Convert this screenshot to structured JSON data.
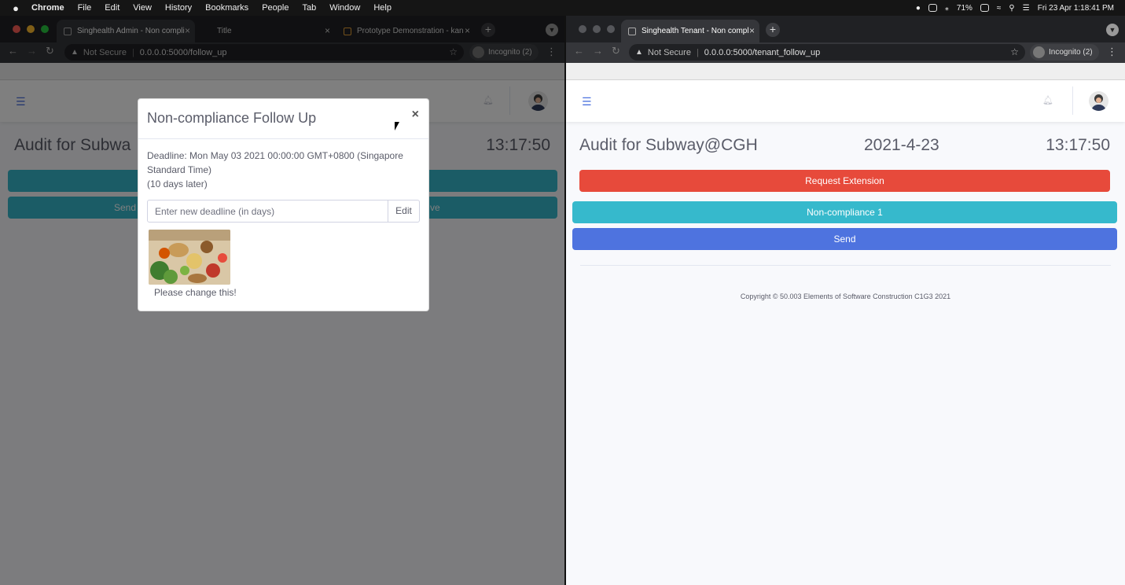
{
  "menubar": {
    "apple": "",
    "app_name": "Chrome",
    "items": [
      "File",
      "Edit",
      "View",
      "History",
      "Bookmarks",
      "People",
      "Tab",
      "Window",
      "Help"
    ],
    "battery": "71%",
    "datetime": "Fri 23 Apr  1:18:41 PM"
  },
  "left_window": {
    "tabs": [
      {
        "title": "Singhealth Admin - Non compli"
      },
      {
        "title": "Title"
      },
      {
        "title": "Prototype Demonstration - kan"
      }
    ],
    "omnibox": {
      "not_secure": "Not Secure",
      "url": "0.0.0.0:5000/follow_up"
    },
    "incognito_label": "Incognito (2)",
    "page": {
      "title_fragment": "Audit for Subwa",
      "time": "13:17:50",
      "send_fragment": "Send",
      "approve_fragment": "ve"
    },
    "modal": {
      "title": "Non-compliance Follow Up",
      "close": "×",
      "deadline_line1": "Deadline: Mon May 03 2021 00:00:00 GMT+0800 (Singapore",
      "deadline_line2": "Standard Time)",
      "deadline_line3": "(10 days later)",
      "input_placeholder": "Enter new deadline (in days)",
      "edit_label": "Edit",
      "image_caption": "Please change this!"
    }
  },
  "right_window": {
    "tabs": [
      {
        "title": "Singhealth Tenant - Non compl"
      }
    ],
    "omnibox": {
      "not_secure": "Not Secure",
      "url": "0.0.0.0:5000/tenant_follow_up"
    },
    "incognito_label": "Incognito (2)",
    "page": {
      "title": "Audit for Subway@CGH",
      "date": "2021-4-23",
      "time": "13:17:50",
      "request_extension": "Request Extension",
      "noncompliance": "Non-compliance 1",
      "send": "Send",
      "copyright": "Copyright © 50.003 Elements of Software Construction C1G3 2021"
    }
  },
  "colors": {
    "primary": "#4e73df",
    "info": "#36b9cc",
    "danger": "#e74a3b",
    "text": "#5a5c69"
  }
}
